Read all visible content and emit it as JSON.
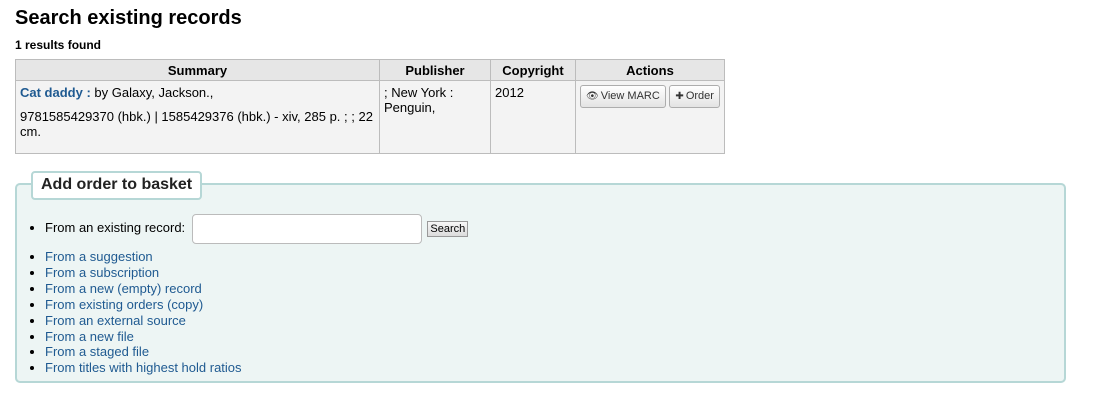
{
  "page": {
    "title": "Search existing records",
    "results_count": "1 results found"
  },
  "table": {
    "headers": [
      "Summary",
      "Publisher",
      "Copyright",
      "Actions"
    ],
    "rows": [
      {
        "title": "Cat daddy :",
        "author": " by Galaxy, Jackson.,",
        "details": "9781585429370 (hbk.) | 1585429376 (hbk.) - xiv, 285 p. ; ; 22 cm.",
        "publisher": "; New York : Penguin,",
        "copyright": "2012",
        "view_marc_label": "View MARC",
        "order_label": "Order"
      }
    ]
  },
  "basket": {
    "legend": "Add order to basket",
    "existing_record_label": "From an existing record:",
    "search_value": "",
    "search_button_label": "Search",
    "links": [
      "From a suggestion",
      "From a subscription",
      "From a new (empty) record",
      "From existing orders (copy)",
      "From an external source",
      "From a new file",
      "From a staged file",
      "From titles with highest hold ratios"
    ]
  },
  "icons": {
    "view_marc": "eye-icon",
    "order": "plus-icon"
  },
  "colors": {
    "link": "#1f5a91",
    "fieldset_bg": "#edf5f4",
    "fieldset_border": "#b6d7d6"
  }
}
